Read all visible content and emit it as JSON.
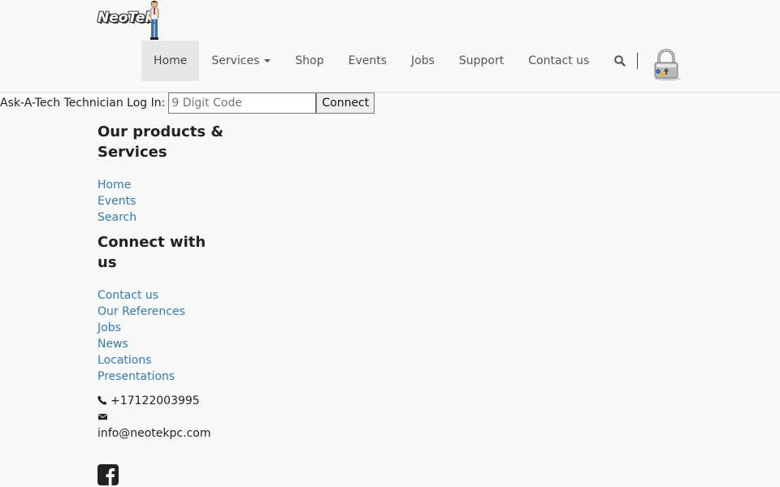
{
  "brand": {
    "logo_text": "NeoTek"
  },
  "nav": {
    "items": [
      {
        "label": "Home",
        "active": true
      },
      {
        "label": "Services",
        "dropdown": true
      },
      {
        "label": "Shop"
      },
      {
        "label": "Events"
      },
      {
        "label": "Jobs"
      },
      {
        "label": "Support"
      },
      {
        "label": "Contact us"
      }
    ],
    "icons": [
      "search-icon",
      "lock-icon"
    ]
  },
  "ask_tech": {
    "label": "Ask-A-Tech Technician Log In:",
    "input_placeholder": "9 Digit Code",
    "input_value": "",
    "button_label": "Connect"
  },
  "products": {
    "heading": "Our products & Services",
    "links": [
      "Home",
      "Events",
      "Search"
    ]
  },
  "connect": {
    "heading": "Connect with us",
    "links": [
      "Contact us",
      "Our References",
      "Jobs",
      "News",
      "Locations",
      "Presentations"
    ]
  },
  "contact": {
    "phone": "+17122003995",
    "email": "info@neotekpc.com"
  },
  "social": [
    "facebook-icon"
  ],
  "colors": {
    "link": "#337ab7",
    "nav_active_bg": "#e7e7e7",
    "background": "#f9f9f9"
  }
}
